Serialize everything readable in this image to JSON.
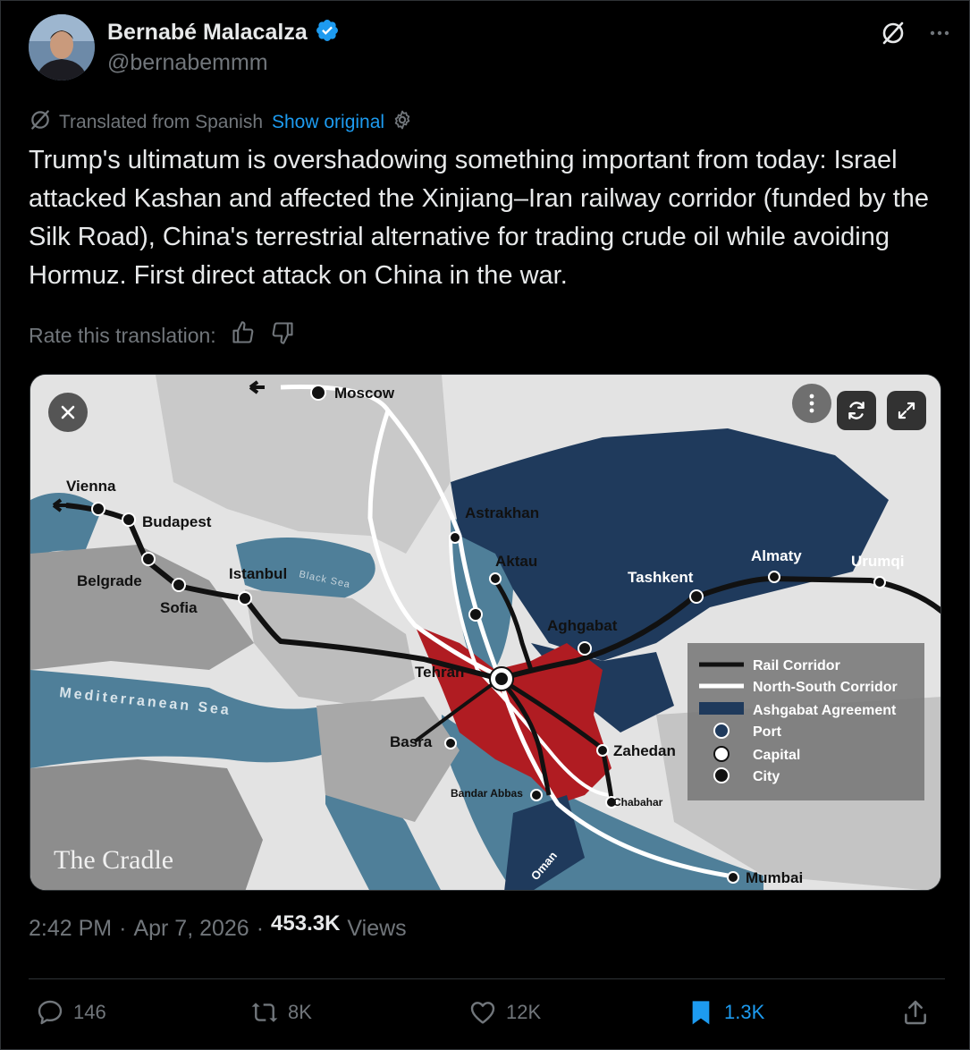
{
  "author": {
    "name": "Bernabé Malacalza",
    "handle": "@bernabemmm",
    "verified": true
  },
  "translation": {
    "notice": "Translated from Spanish",
    "show_original": "Show original",
    "rate_label": "Rate this translation:"
  },
  "tweet": {
    "text": "Trump's ultimatum is overshadowing something important from today: Israel attacked Kashan and affected the Xinjiang–Iran railway corridor (funded by the Silk Road), China's terrestrial alternative for trading crude oil while avoiding Hormuz. First direct attack on China in the war."
  },
  "map": {
    "places": {
      "moscow": "Moscow",
      "vienna": "Vienna",
      "budapest": "Budapest",
      "belgrade": "Belgrade",
      "sofia": "Sofia",
      "istanbul": "Istanbul",
      "black_sea": "Black Sea",
      "astrakhan": "Astrakhan",
      "aktau": "Aktau",
      "tashkent": "Tashkent",
      "almaty": "Almaty",
      "urumqi": "Urumqi",
      "aghgabat": "Aghgabat",
      "tehran": "Tehran",
      "mediterranean": "Mediterranean Sea",
      "basra": "Basra",
      "zahedan": "Zahedan",
      "bandar_abbas": "Bandar Abbas",
      "chabahar": "Chabahar",
      "oman": "Oman",
      "mumbai": "Mumbai"
    },
    "legend": {
      "rail": "Rail Corridor",
      "north_south": "North-South Corridor",
      "ashgabat": "Ashgabat Agreement",
      "port": "Port",
      "capital": "Capital",
      "city": "City"
    },
    "watermark": "The Cradle",
    "colors": {
      "iran": "#b01c22",
      "agreement": "#1f3a5c",
      "sea": "#4f7f99"
    }
  },
  "meta": {
    "time": "2:42 PM",
    "separator": "·",
    "date": "Apr 7, 2026",
    "separator2": "·",
    "views_count": "453.3K",
    "views_label": "Views"
  },
  "actions": {
    "replies": "146",
    "reposts": "8K",
    "likes": "12K",
    "bookmarks": "1.3K"
  },
  "colors": {
    "accent": "#1d9bf0",
    "muted": "#71767b",
    "text": "#e7e9ea",
    "background": "#000000"
  }
}
